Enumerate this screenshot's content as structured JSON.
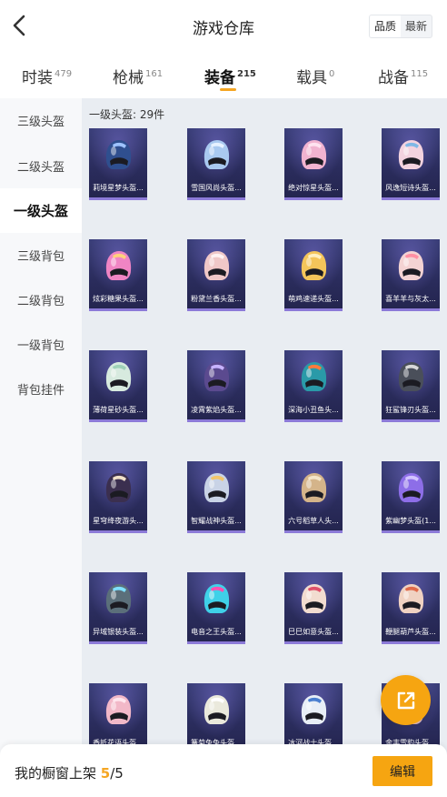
{
  "header": {
    "title": "游戏仓库",
    "sort_quality": "品质",
    "sort_latest": "最新"
  },
  "tabs": [
    {
      "label": "时装",
      "count": "479",
      "active": false
    },
    {
      "label": "枪械",
      "count": "161",
      "active": false
    },
    {
      "label": "装备",
      "count": "215",
      "active": true
    },
    {
      "label": "载具",
      "count": "0",
      "active": false
    },
    {
      "label": "战备",
      "count": "115",
      "active": false
    }
  ],
  "sidebar": {
    "items": [
      {
        "label": "三级头盔",
        "active": false
      },
      {
        "label": "二级头盔",
        "active": false
      },
      {
        "label": "一级头盔",
        "active": true
      },
      {
        "label": "三级背包",
        "active": false
      },
      {
        "label": "二级背包",
        "active": false
      },
      {
        "label": "一级背包",
        "active": false
      },
      {
        "label": "背包挂件",
        "active": false
      }
    ]
  },
  "main": {
    "count_label": "一级头盔: 29件",
    "items": [
      {
        "name": "莉境星梦头盔...",
        "color": "#2f4f8f",
        "accent": "#9ec3ff"
      },
      {
        "name": "雪国风尚头盔...",
        "color": "#a9c9f0",
        "accent": "#e6f1ff"
      },
      {
        "name": "绝对惊星头盔...",
        "color": "#f1b3d0",
        "accent": "#ffe3f0"
      },
      {
        "name": "风逸短诗头盔...",
        "color": "#f3d3df",
        "accent": "#7fb8e6"
      },
      {
        "name": "炫彩糖果头盔...",
        "color": "#f085c4",
        "accent": "#ffd27a"
      },
      {
        "name": "粉黛兰香头盔...",
        "color": "#f0c8c8",
        "accent": "#fff2f2"
      },
      {
        "name": "萌鸡速递头盔...",
        "color": "#f4c55a",
        "accent": "#fff0c2"
      },
      {
        "name": "喜羊羊与灰太...",
        "color": "#f4d3d3",
        "accent": "#ff8fa3"
      },
      {
        "name": "薄荷星砂头盔...",
        "color": "#d7eadf",
        "accent": "#9fd1b8"
      },
      {
        "name": "凌霄紫焰头盔...",
        "color": "#5b4a8f",
        "accent": "#c7b3ff"
      },
      {
        "name": "深海小丑鱼头...",
        "color": "#2a9aa8",
        "accent": "#ff7a3c"
      },
      {
        "name": "狂鲨锋刃头盔...",
        "color": "#4a4f5a",
        "accent": "#d9d9d9"
      },
      {
        "name": "星穹绛夜游头...",
        "color": "#3b2f4f",
        "accent": "#f0e0c8"
      },
      {
        "name": "智耀战神头盔...",
        "color": "#c9d3e6",
        "accent": "#f2c66b"
      },
      {
        "name": "六号稻草人头...",
        "color": "#d4b48a",
        "accent": "#f5e6c8"
      },
      {
        "name": "紫幽梦头盔(1...",
        "color": "#8d6ee8",
        "accent": "#d2c4ff"
      },
      {
        "name": "异域银装头盔...",
        "color": "#5b6f7a",
        "accent": "#7fe0ff"
      },
      {
        "name": "电音之王头盔...",
        "color": "#3fd1e8",
        "accent": "#ff4fb0"
      },
      {
        "name": "巳巳如意头盔...",
        "color": "#f2dcd0",
        "accent": "#e0506a"
      },
      {
        "name": "鞭腿葫芦头盔...",
        "color": "#f0d2c2",
        "accent": "#e06a4a"
      },
      {
        "name": "香抵花语头盔...",
        "color": "#f2b8c8",
        "accent": "#ffe6ee"
      },
      {
        "name": "篝菊兔兔头盔...",
        "color": "#eae9dc",
        "accent": "#ffffff"
      },
      {
        "name": "冰河战士头盔...",
        "color": "#e8eef6",
        "accent": "#4a7fd0"
      },
      {
        "name": "金丰雪豹头盔...",
        "color": "#f2c8d0",
        "accent": "#ffffff"
      }
    ]
  },
  "bottom": {
    "shelf_label": "我的橱窗上架",
    "shelf_current": "5",
    "shelf_total": "/5",
    "edit_label": "编辑"
  }
}
